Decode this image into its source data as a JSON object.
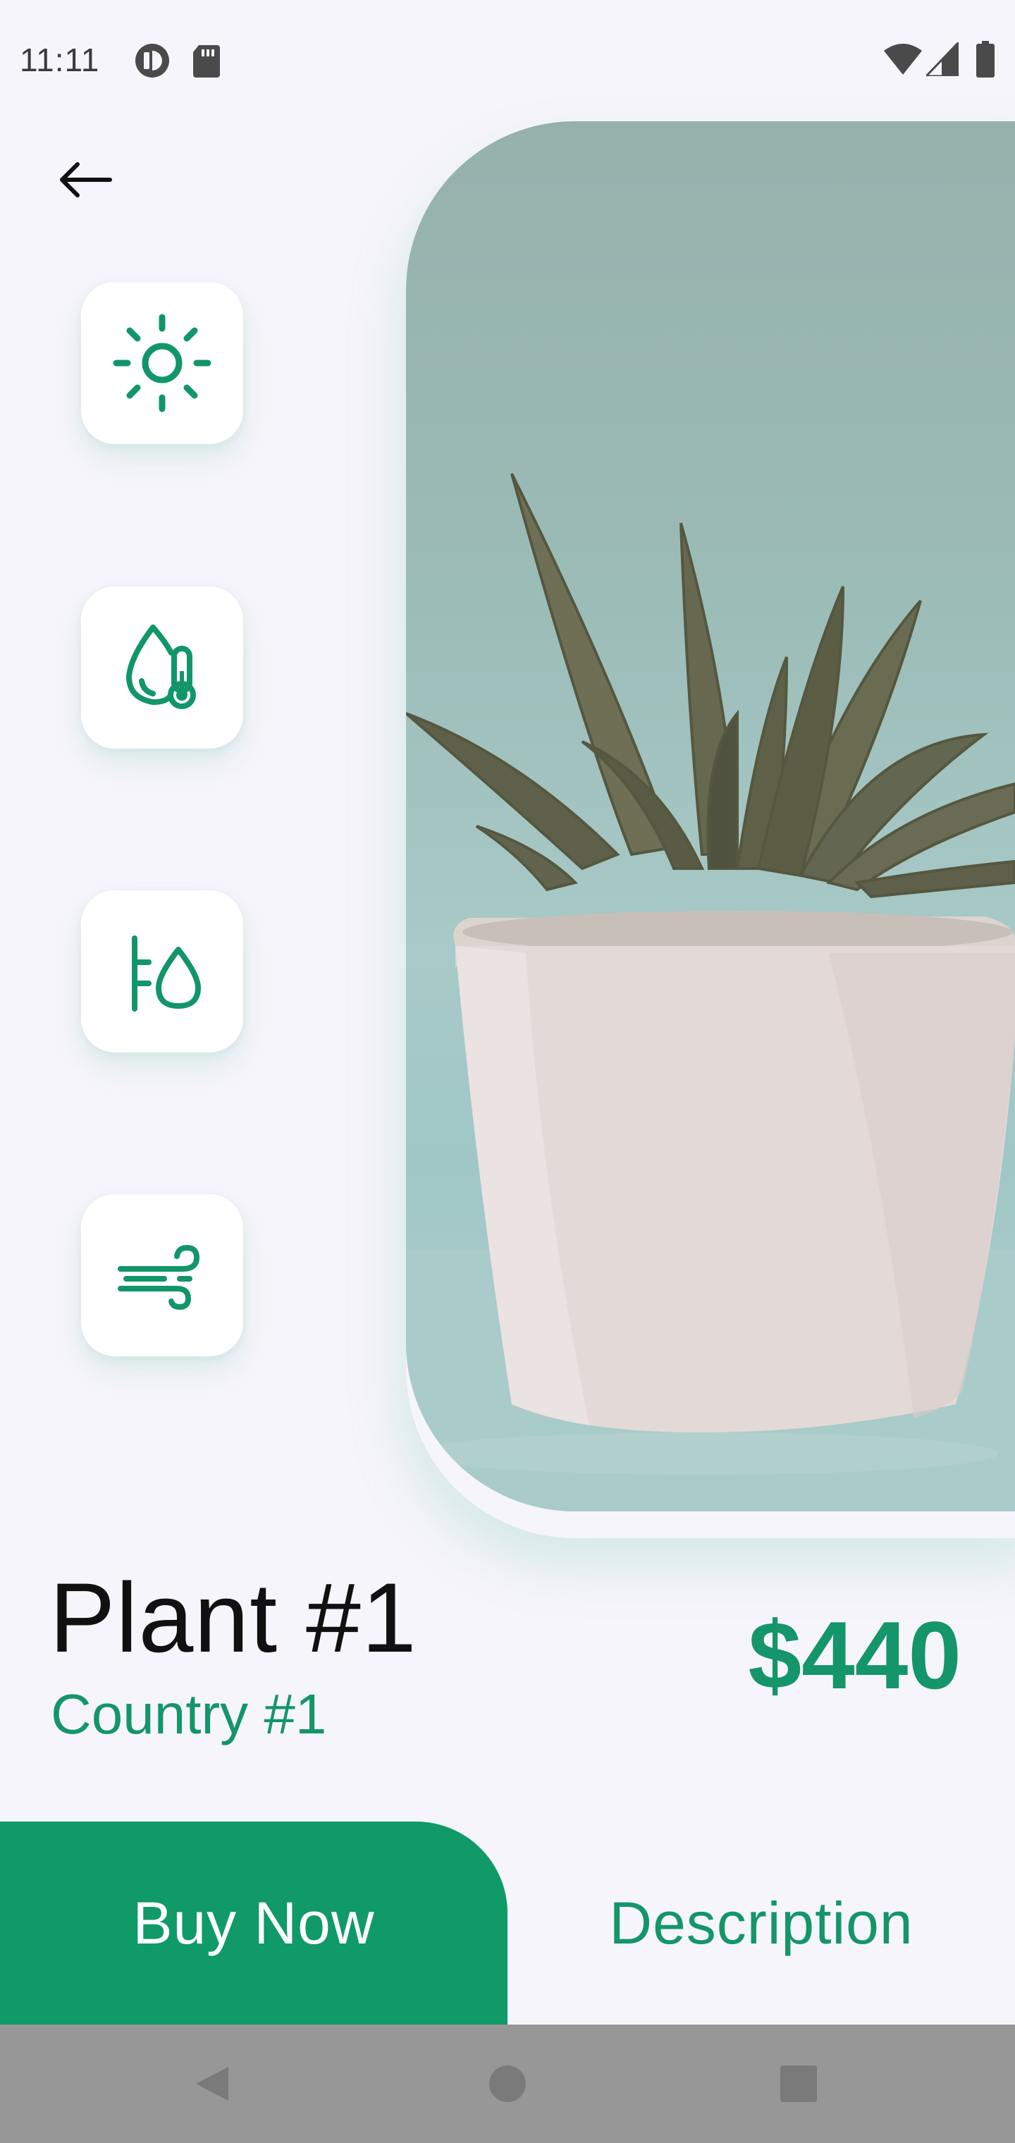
{
  "status_bar": {
    "time": "11:11",
    "icons": [
      "app-notification-icon",
      "sd-card-icon",
      "wifi-icon",
      "cell-signal-icon",
      "battery-icon"
    ]
  },
  "top_bar": {
    "back_icon": "arrow-left-icon",
    "more_icon": "more-horizontal-icon"
  },
  "features": [
    {
      "icon": "sun-icon"
    },
    {
      "icon": "humidity-thermometer-icon"
    },
    {
      "icon": "watering-icon"
    },
    {
      "icon": "wind-icon"
    }
  ],
  "plant": {
    "name": "Plant #1",
    "country": "Country #1",
    "price": "$440"
  },
  "actions": {
    "buy_label": "Buy Now",
    "description_label": "Description"
  },
  "colors": {
    "accent": "#0f9a68",
    "accent_text": "#14956a",
    "background": "#f6f5fb",
    "nav_bar": "#979797"
  }
}
